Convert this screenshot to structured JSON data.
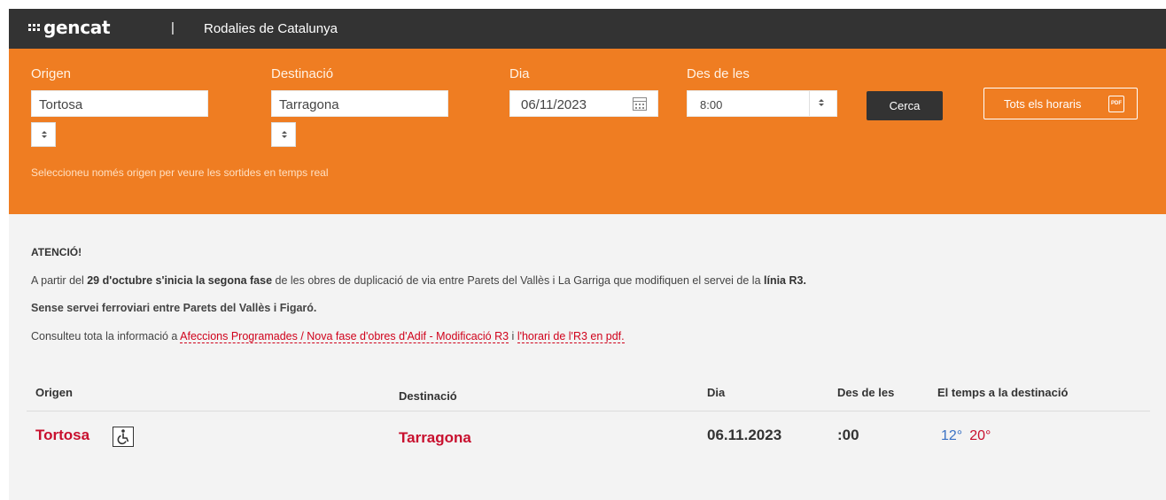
{
  "header": {
    "logo_text": "gencat",
    "separator": "|",
    "app_title": "Rodalies de Catalunya"
  },
  "search": {
    "origin_label": "Origen",
    "origin_value": "Tortosa",
    "destination_label": "Destinació",
    "destination_value": "Tarragona",
    "day_label": "Dia",
    "day_value": "06/11/2023",
    "time_label": "Des de les",
    "time_value": "8:00",
    "search_button": "Cerca",
    "all_schedules_button": "Tots els horaris",
    "pdf_icon_text": "PDF",
    "hint": "Seleccioneu només origen per veure les sortides en temps real",
    "accent_color": "#ef7d22"
  },
  "notice": {
    "title": "ATENCIÓ!",
    "line1_a": "A partir del ",
    "line1_b": "29 d'octubre s'inicia la segona fase",
    "line1_c": " de les obres de duplicació de via entre Parets del Vallès i La Garriga que modifiquen el servei de la ",
    "line1_d": "línia R3.",
    "line2": "Sense servei ferroviari entre Parets del Vallès i Figaró.",
    "line3_a": "Consulteu tota la informació a ",
    "line3_link1": "Afeccions Programades / Nova fase d'obres d'Adif - Modificació R3",
    "line3_b": " i ",
    "line3_link2": "l'horari de l'R3 en pdf."
  },
  "results": {
    "headers": [
      "Origen",
      "Destinació",
      "Dia",
      "Des de les",
      "El temps a la destinació"
    ],
    "row": {
      "origin": "Tortosa",
      "destination": "Tarragona",
      "day": "06.11.2023",
      "time": ":00",
      "temp_min": "12°",
      "temp_max": "20°"
    },
    "accessibility_icon": "wheelchair-icon"
  }
}
